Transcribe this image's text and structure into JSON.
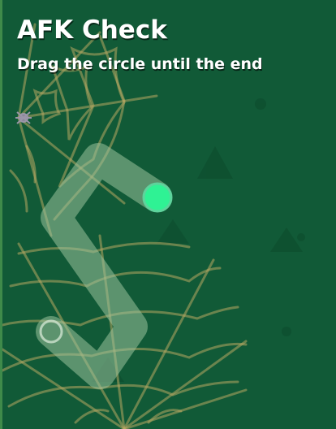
{
  "dialog": {
    "title": "AFK Check",
    "instruction": "Drag the circle until the end"
  },
  "colors": {
    "background": "#115a37",
    "web": "#b6a763",
    "track": "#9bc29d",
    "handle": "#2ff294"
  },
  "icons": {
    "web": "spider-web-icon",
    "handle": "drag-handle-circle",
    "target": "track-end-circle"
  }
}
